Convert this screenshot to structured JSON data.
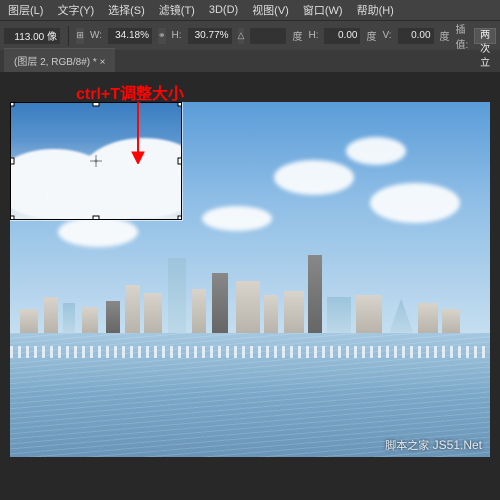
{
  "menu": {
    "items": [
      "图层(L)",
      "文字(Y)",
      "选择(S)",
      "滤镜(T)",
      "3D(D)",
      "视图(V)",
      "窗口(W)",
      "帮助(H)"
    ]
  },
  "options": {
    "zoom": "113.00 像",
    "w_label": "W:",
    "w_value": "34.18%",
    "link_icon": "⚭",
    "h_label": "H:",
    "h_value": "30.77%",
    "angle_label": "度",
    "horizontal_label": "H:",
    "horizontal_value": "0.00",
    "deg1": "度",
    "vertical_label": "V:",
    "vertical_value": "0.00",
    "deg2": "度",
    "interp_label": "插值:",
    "interp_value": "两次立"
  },
  "tab": {
    "label": "(图层 2, RGB/8#) * ×"
  },
  "annotation": {
    "text": "ctrl+T调整大小"
  },
  "watermark": {
    "site": "JS51.Net",
    "cn": "脚本之家"
  }
}
